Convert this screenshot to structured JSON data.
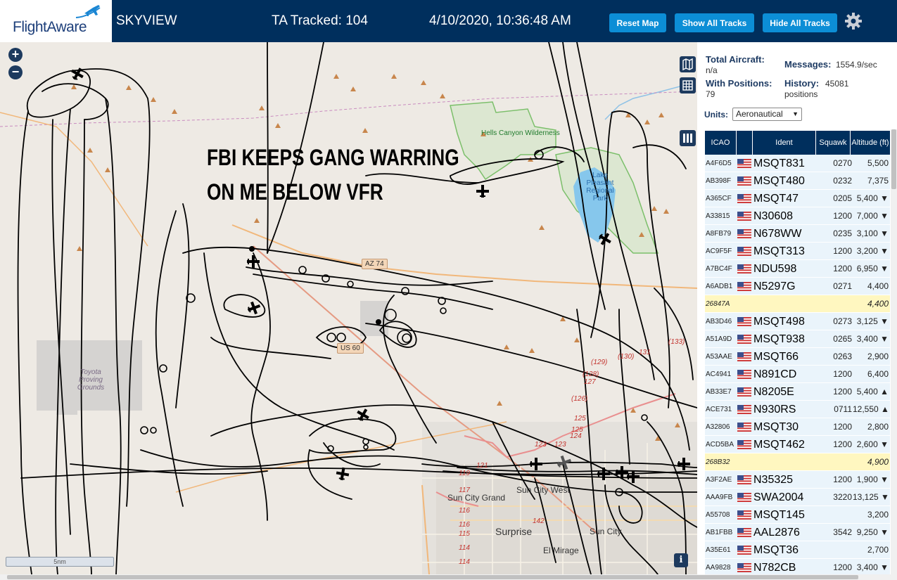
{
  "header": {
    "logo_text": "FlightAware",
    "app_name": "SKYVIEW",
    "tracked": "TA Tracked: 104",
    "timestamp": "4/10/2020, 10:36:48 AM",
    "buttons": {
      "reset": "Reset Map",
      "show_all": "Show All Tracks",
      "hide_all": "Hide All Tracks"
    },
    "settings_icon": "gear-icon"
  },
  "map": {
    "overlay_text": [
      "FBI KEEPS GANG WARRING",
      "ON ME BELOW VFR"
    ],
    "scale_label": "5nm",
    "zoom_in": "+",
    "zoom_out": "−",
    "info": "i",
    "towns": {
      "surprise": "Surprise",
      "sun_city_west": "Sun City West",
      "sun_city_grand": "Sun City Grand",
      "sun_city": "Sun City",
      "el_mirage": "El Mirage"
    },
    "parks": {
      "hells_canyon": "Hells Canyon Wilderness",
      "lake_pleasant": "Lake Pleasant Regional Park",
      "toyota": "Toyota Proving Grounds"
    },
    "shields": {
      "az74": "AZ 74",
      "us60": "US 60"
    },
    "route_numbers": [
      "(133)",
      "131",
      "(130)",
      "(129)",
      "(128)",
      "127",
      "(126)",
      "125",
      "125",
      "124",
      "123",
      "123",
      "121",
      "119",
      "117",
      "116",
      "116",
      "115",
      "114",
      "114",
      "142"
    ],
    "icons": [
      "map-layers-icon",
      "grid-icon",
      "columns-icon",
      "airplane-icon"
    ]
  },
  "panel": {
    "stats": {
      "total_aircraft_label": "Total Aircraft:",
      "total_aircraft_value": "n/a",
      "messages_label": "Messages:",
      "messages_value": "1554.9/sec",
      "with_positions_label": "With Positions:",
      "with_positions_value": "79",
      "history_label": "History:",
      "history_value": "45081 positions"
    },
    "units_label": "Units:",
    "units_value": "Aeronautical",
    "columns": [
      "ICAO",
      "",
      "Ident",
      "Squawk",
      "Altitude (ft)"
    ],
    "rows": [
      {
        "icao": "A4F6D5",
        "ident": "MSQT831",
        "squawk": "0270",
        "alt": "5,500",
        "flag": true
      },
      {
        "icao": "AB398F",
        "ident": "MSQT480",
        "squawk": "0232",
        "alt": "7,375",
        "flag": true
      },
      {
        "icao": "A365CF",
        "ident": "MSQT47",
        "squawk": "0205",
        "alt": "5,400 ▼",
        "flag": true
      },
      {
        "icao": "A33815",
        "ident": "N30608",
        "squawk": "1200",
        "alt": "7,000 ▼",
        "flag": true
      },
      {
        "icao": "A8FB79",
        "ident": "N678WW",
        "squawk": "0235",
        "alt": "3,100 ▼",
        "flag": true
      },
      {
        "icao": "AC9F5F",
        "ident": "MSQT313",
        "squawk": "1200",
        "alt": "3,200 ▼",
        "flag": true
      },
      {
        "icao": "A7BC4F",
        "ident": "NDU598",
        "squawk": "1200",
        "alt": "6,950 ▼",
        "flag": true
      },
      {
        "icao": "A6ADB1",
        "ident": "N5297G",
        "squawk": "0271",
        "alt": "4,400",
        "flag": true
      },
      {
        "icao": "26847A",
        "ident": "",
        "squawk": "",
        "alt": "4,400",
        "flag": false
      },
      {
        "icao": "AB3D46",
        "ident": "MSQT498",
        "squawk": "0273",
        "alt": "3,125 ▼",
        "flag": true
      },
      {
        "icao": "A51A9D",
        "ident": "MSQT938",
        "squawk": "0265",
        "alt": "3,400 ▼",
        "flag": true
      },
      {
        "icao": "A53AAE",
        "ident": "MSQT66",
        "squawk": "0263",
        "alt": "2,900",
        "flag": true
      },
      {
        "icao": "AC4941",
        "ident": "N891CD",
        "squawk": "1200",
        "alt": "6,400",
        "flag": true
      },
      {
        "icao": "AB33E7",
        "ident": "N8205E",
        "squawk": "1200",
        "alt": "5,400 ▲",
        "flag": true
      },
      {
        "icao": "ACE731",
        "ident": "N930RS",
        "squawk": "0711",
        "alt": "12,550 ▲",
        "flag": true
      },
      {
        "icao": "A32806",
        "ident": "MSQT30",
        "squawk": "1200",
        "alt": "2,800",
        "flag": true
      },
      {
        "icao": "ACD5BA",
        "ident": "MSQT462",
        "squawk": "1200",
        "alt": "2,600 ▼",
        "flag": true
      },
      {
        "icao": "268B32",
        "ident": "",
        "squawk": "",
        "alt": "4,900",
        "flag": false
      },
      {
        "icao": "A3F2AE",
        "ident": "N35325",
        "squawk": "1200",
        "alt": "1,900 ▼",
        "flag": true
      },
      {
        "icao": "AAA9FB",
        "ident": "SWA2004",
        "squawk": "3220",
        "alt": "13,125 ▼",
        "flag": true
      },
      {
        "icao": "A55708",
        "ident": "MSQT145",
        "squawk": "",
        "alt": "3,200",
        "flag": true
      },
      {
        "icao": "AB1FBB",
        "ident": "AAL2876",
        "squawk": "3542",
        "alt": "9,250 ▼",
        "flag": true
      },
      {
        "icao": "A35E61",
        "ident": "MSQT36",
        "squawk": "",
        "alt": "2,700",
        "flag": true
      },
      {
        "icao": "AA9828",
        "ident": "N782CB",
        "squawk": "1200",
        "alt": "3,400 ▼",
        "flag": true
      }
    ]
  },
  "colors": {
    "header_bg": "#002f5d",
    "button_bg": "#0c8ed6",
    "track_line": "#000000",
    "park_border": "#7bbf6a",
    "lake": "#86c7ec",
    "no_position_row": "#fff7c0",
    "row_bg": "#eaf4fb"
  }
}
